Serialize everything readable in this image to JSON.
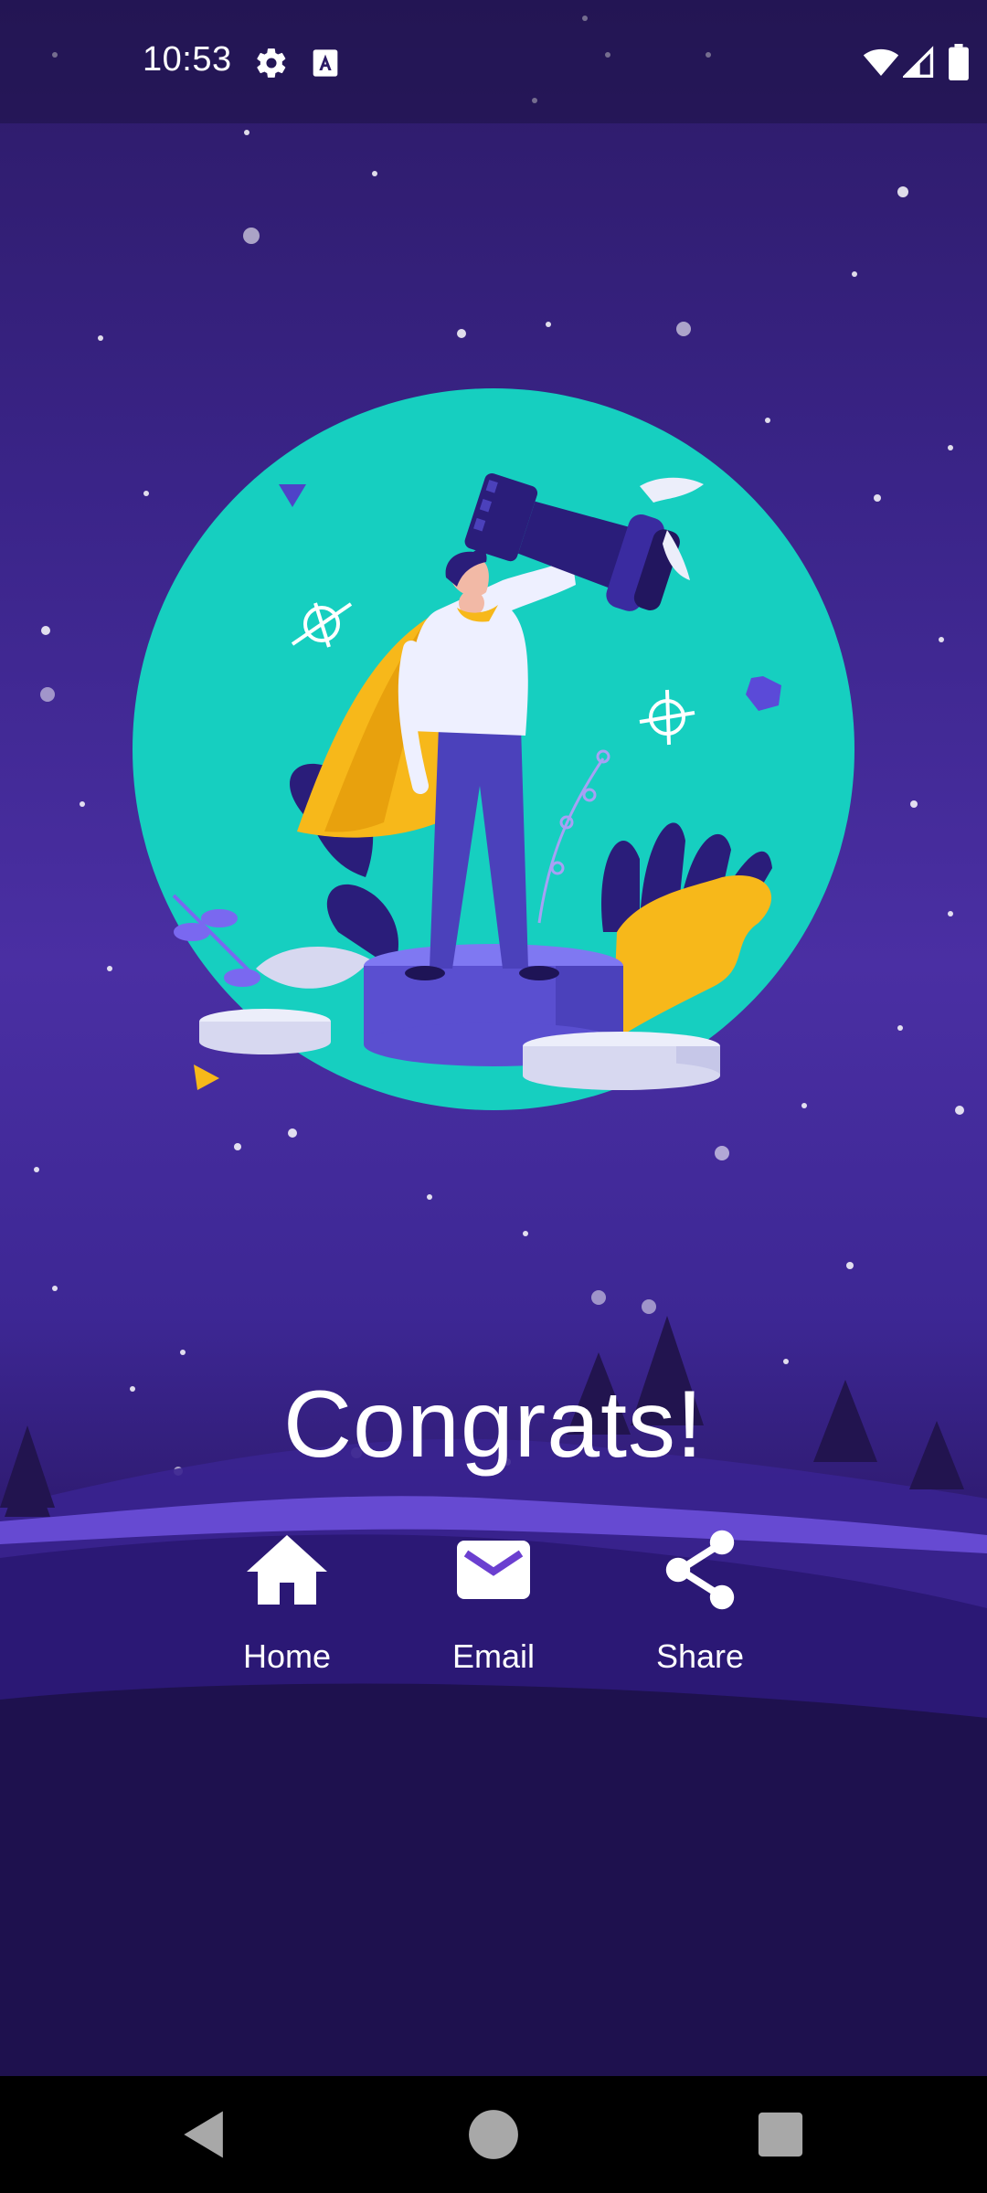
{
  "status_bar": {
    "time": "10:53",
    "icons": [
      "settings-icon",
      "text-a-icon",
      "wifi-icon",
      "signal-icon",
      "battery-icon"
    ]
  },
  "main": {
    "title": "Congrats!",
    "illustration": "hero-with-chess-rook-icon",
    "actions": [
      {
        "label": "Home",
        "icon": "home-icon"
      },
      {
        "label": "Email",
        "icon": "email-icon"
      },
      {
        "label": "Share",
        "icon": "share-icon"
      }
    ]
  },
  "nav_bar": {
    "buttons": [
      "back-icon",
      "home-circle-icon",
      "recents-icon"
    ]
  },
  "colors": {
    "background_top": "#2c1a66",
    "background_mid": "#4a2fa3",
    "background_bottom": "#140d30",
    "circle_teal": "#16cfc0",
    "accent_yellow": "#f7b81a",
    "text": "#ffffff"
  }
}
